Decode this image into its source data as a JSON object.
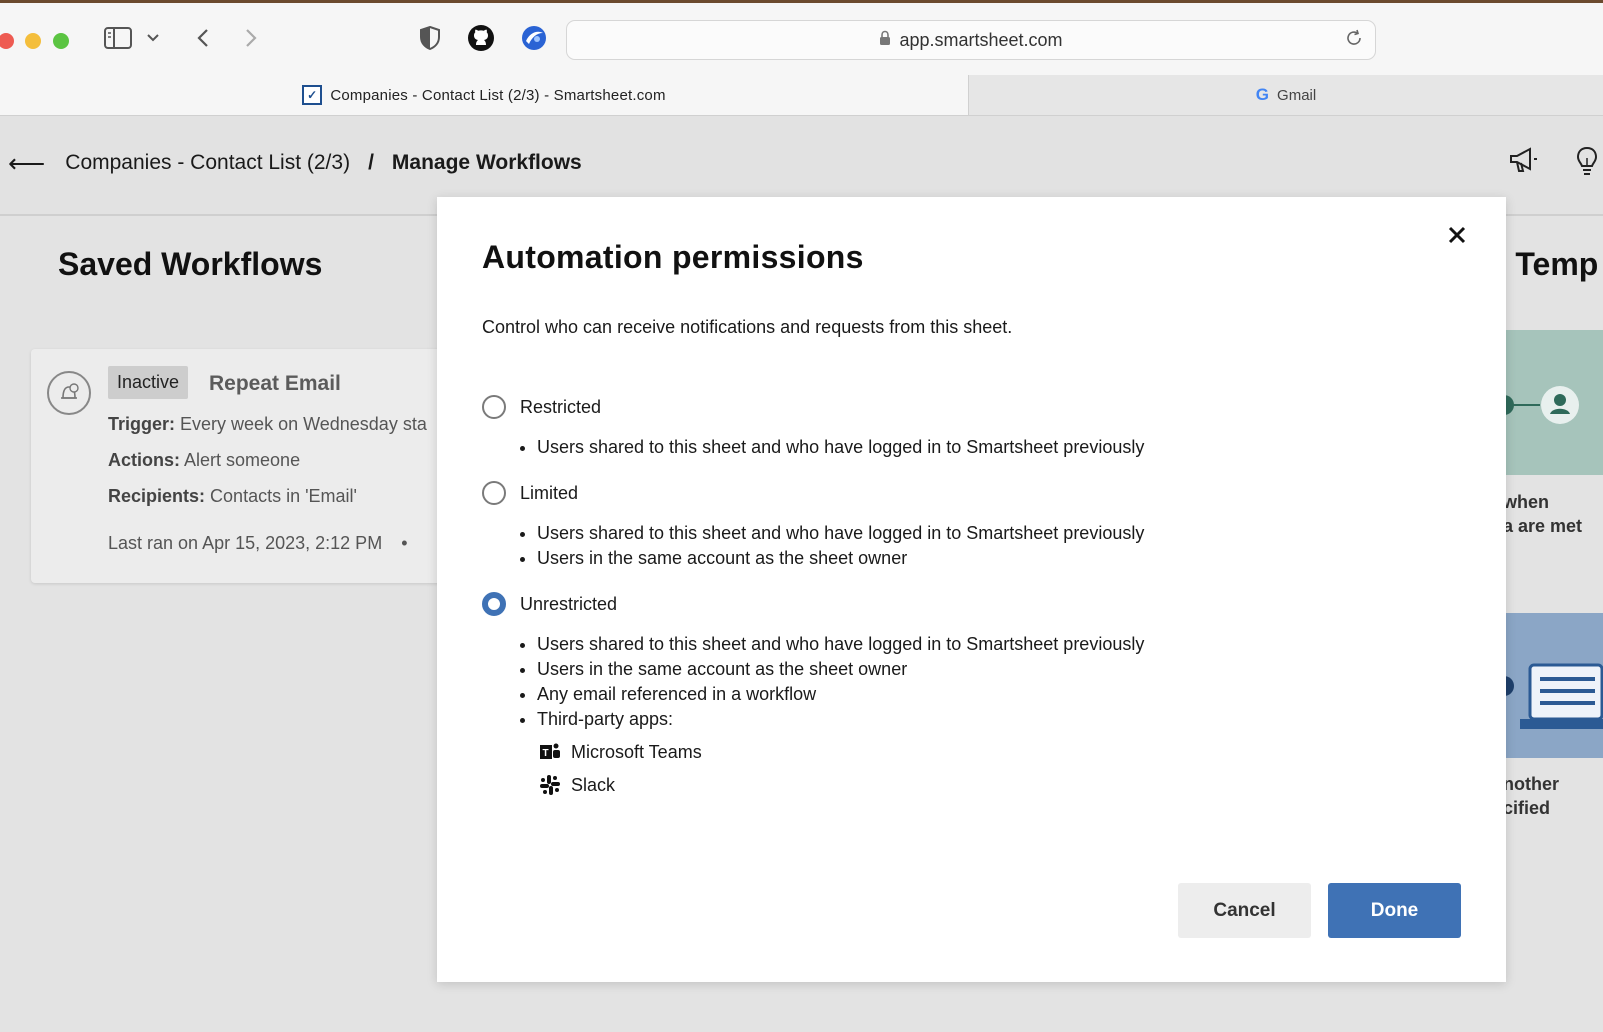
{
  "browser": {
    "url": "app.smartsheet.com",
    "tabs": [
      {
        "label": "Companies - Contact List (2/3) - Smartsheet.com",
        "active": true
      },
      {
        "label": "Gmail",
        "active": false
      }
    ]
  },
  "header": {
    "back_icon": "arrow-left-icon",
    "breadcrumb_sheet": "Companies - Contact List (2/3)",
    "breadcrumb_separator": "/",
    "breadcrumb_current": "Manage Workflows"
  },
  "saved_workflows": {
    "title": "Saved Workflows",
    "card": {
      "status": "Inactive",
      "name": "Repeat Email",
      "trigger_label": "Trigger:",
      "trigger_value": "Every week on Wednesday sta",
      "actions_label": "Actions:",
      "actions_value": "Alert someone",
      "recipients_label": "Recipients:",
      "recipients_value": "Contacts in 'Email'",
      "last_ran": "Last ran on Apr 15, 2023, 2:12 PM",
      "dot": "•"
    }
  },
  "templates_panel": {
    "title_fragment": "r Temp",
    "tile1_text": [
      "when",
      "a are met"
    ],
    "tile2_text": [
      "nother",
      "cified"
    ]
  },
  "modal": {
    "title": "Automation permissions",
    "description": "Control who can receive notifications and requests from this sheet.",
    "options": [
      {
        "label": "Restricted",
        "selected": false,
        "bullets": [
          "Users shared to this sheet and who have logged in to Smartsheet previously"
        ]
      },
      {
        "label": "Limited",
        "selected": false,
        "bullets": [
          "Users shared to this sheet and who have logged in to Smartsheet previously",
          "Users in the same account as the sheet owner"
        ]
      },
      {
        "label": "Unrestricted",
        "selected": true,
        "bullets": [
          "Users shared to this sheet and who have logged in to Smartsheet previously",
          "Users in the same account as the sheet owner",
          "Any email referenced in a workflow",
          "Third-party apps:"
        ]
      }
    ],
    "apps": [
      {
        "name": "Microsoft Teams",
        "icon": "microsoft-teams-icon"
      },
      {
        "name": "Slack",
        "icon": "slack-icon"
      }
    ],
    "cancel_label": "Cancel",
    "done_label": "Done"
  },
  "colors": {
    "primary": "#3f72b5",
    "backdrop": "#e3e3e3"
  }
}
